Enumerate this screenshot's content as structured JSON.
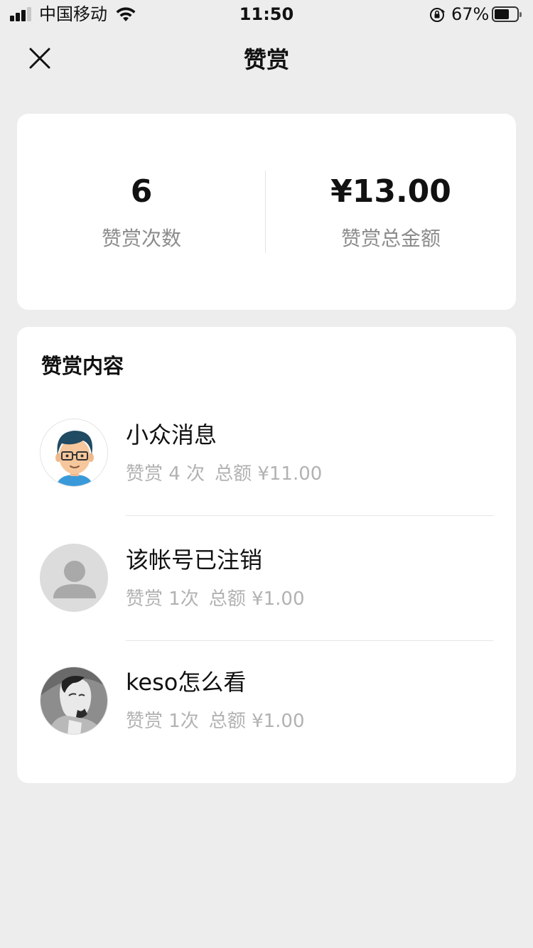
{
  "status_bar": {
    "carrier": "中国移动",
    "time": "11:50",
    "battery_percent_text": "67%",
    "battery_level": 0.67,
    "signal_bars": 3,
    "icons": [
      "signal-icon",
      "wifi-icon",
      "orientation-lock-icon",
      "battery-icon"
    ]
  },
  "nav": {
    "title": "赞赏",
    "close_icon": "close-icon"
  },
  "summary": {
    "count_value": "6",
    "count_label": "赞赏次数",
    "total_value": "¥13.00",
    "total_label": "赞赏总金额"
  },
  "content": {
    "section_title": "赞赏内容",
    "items": [
      {
        "name": "小众消息",
        "times": "赞赏 4 次",
        "total": "总额 ¥11.00",
        "avatar": "cartoon-avatar"
      },
      {
        "name": "该帐号已注销",
        "times": "赞赏 1次",
        "total": "总额 ¥1.00",
        "avatar": "default-user-avatar"
      },
      {
        "name": "keso怎么看",
        "times": "赞赏 1次",
        "total": "总额 ¥1.00",
        "avatar": "photo-avatar"
      }
    ]
  },
  "colors": {
    "background": "#ededed",
    "card": "#ffffff",
    "primary_text": "#111111",
    "secondary_text": "#8c8c8c",
    "meta_text": "#b2b2b2",
    "divider": "#e6e6e6"
  }
}
